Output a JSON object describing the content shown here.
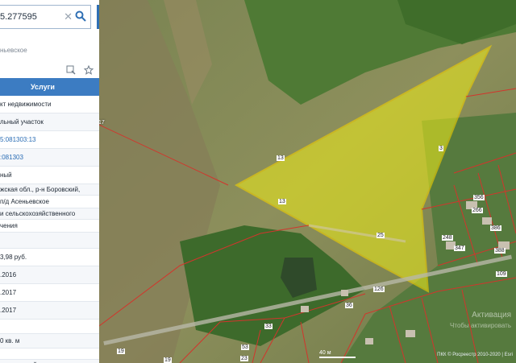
{
  "search": {
    "value": "5.277595"
  },
  "panel": {
    "address_line": "ньевское",
    "tab_label": "Услуги",
    "rows": [
      {
        "text": "кт недвижимости",
        "link": false,
        "h": 22
      },
      {
        "text": "льный участок",
        "link": false,
        "h": 22
      },
      {
        "text": "5:081303:13",
        "link": true,
        "h": 22
      },
      {
        "text": ":081303",
        "link": true,
        "h": 22
      },
      {
        "text": "ный",
        "link": false,
        "h": 22
      },
      {
        "text": "жская обл., р-н Боровский,",
        "link": false,
        "h": 14
      },
      {
        "text": "п/д Асеньевское",
        "link": false,
        "h": 16
      },
      {
        "text": "и сельскохозяйственного",
        "link": false,
        "h": 14
      },
      {
        "text": "чения",
        "link": false,
        "h": 16
      },
      {
        "text": "",
        "link": false,
        "h": 20
      },
      {
        "text": "3,98 руб.",
        "link": false,
        "h": 22
      },
      {
        "text": ".2016",
        "link": false,
        "h": 22
      },
      {
        "text": ".2017",
        "link": false,
        "h": 22
      },
      {
        "text": ".2017",
        "link": false,
        "h": 22
      },
      {
        "text": "",
        "link": false,
        "h": 18
      },
      {
        "text": "0 кв. м",
        "link": false,
        "h": 18
      },
      {
        "text": "",
        "link": false,
        "h": 14
      },
      {
        "text": "ельскохозяйственного",
        "link": false,
        "h": 14
      }
    ]
  },
  "map": {
    "parcel_labels": [
      "13",
      "13",
      "3",
      "25"
    ],
    "side_label": "17",
    "plot_numbers": [
      "356",
      "266",
      "386",
      "248",
      "347",
      "388",
      "36",
      "109",
      "33",
      "53",
      "19",
      "19",
      "23",
      "126"
    ],
    "scale": "40 м",
    "credits": "ПКК © Росреестр 2010-2020 | Esri",
    "watermark_line1": "Активация",
    "watermark_line2": "Чтобы активировать",
    "colors": {
      "parcel_fill": "#e6e61e",
      "parcel_stroke": "#f2d200",
      "boundary": "#d2352c",
      "accent": "#3c7cc2"
    }
  }
}
